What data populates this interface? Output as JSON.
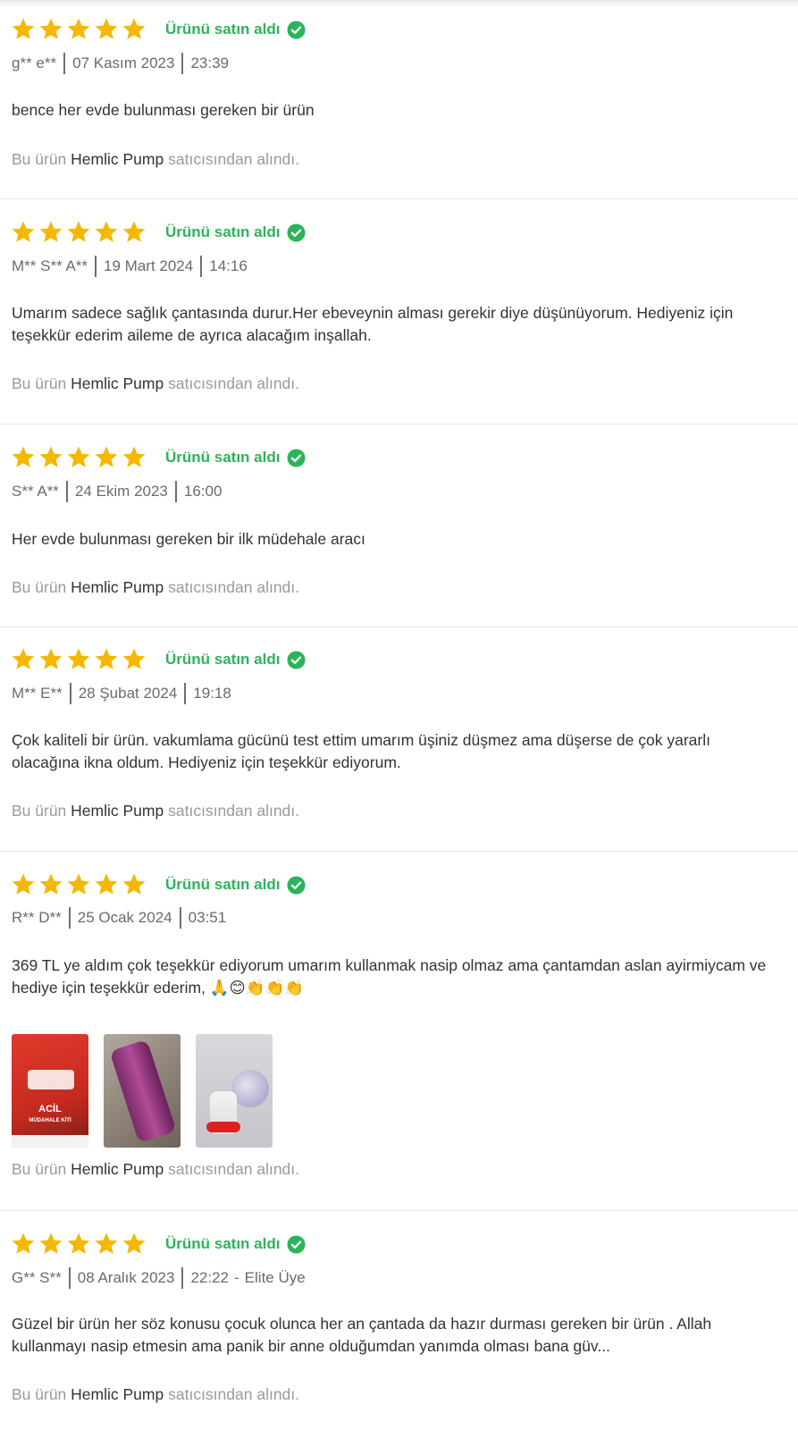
{
  "colors": {
    "star": "#f5b800",
    "bought": "#2cb45a",
    "muted": "#9a9a9a"
  },
  "bought_label": "Ürünü satın aldı",
  "icons": {
    "star": "star-icon",
    "verified": "check-circle-icon"
  },
  "reviews": [
    {
      "rating": 5,
      "user": "g** e**",
      "date": "07 Kasım 2023",
      "time": "23:39",
      "badge": "",
      "text": "bence her evde bulunması gereken bir ürün",
      "seller_prefix": "Bu ürün",
      "seller_name": "Hemlic Pump",
      "seller_suffix": "satıcısından alındı."
    },
    {
      "rating": 5,
      "user": "M** S** A**",
      "date": "19 Mart 2024",
      "time": "14:16",
      "badge": "",
      "text": "Umarım sadece sağlık çantasında durur.Her ebeveynin alması gerekir diye düşünüyorum. Hediyeniz için teşekkür ederim aileme de ayrıca alacağım inşallah.",
      "seller_prefix": "Bu ürün",
      "seller_name": "Hemlic Pump",
      "seller_suffix": "satıcısından alındı."
    },
    {
      "rating": 5,
      "user": "S** A**",
      "date": "24 Ekim 2023",
      "time": "16:00",
      "badge": "",
      "text": "Her evde bulunması gereken bir ilk müdehale aracı",
      "seller_prefix": "Bu ürün",
      "seller_name": "Hemlic Pump",
      "seller_suffix": "satıcısından alındı."
    },
    {
      "rating": 5,
      "user": "M** E**",
      "date": "28 Şubat 2024",
      "time": "19:18",
      "badge": "",
      "text": "Çok kaliteli bir ürün. vakumlama gücünü test ettim umarım üşiniz düşmez ama düşerse de çok yararlı olacağına ikna oldum. Hediyeniz için teşekkür ediyorum.",
      "seller_prefix": "Bu ürün",
      "seller_name": "Hemlic Pump",
      "seller_suffix": "satıcısından alındı."
    },
    {
      "rating": 5,
      "user": "R** D**",
      "date": "25 Ocak 2024",
      "time": "03:51",
      "badge": "",
      "text": "369 TL ye aldım çok teşekkür ediyorum umarım kullanmak nasip olmaz ama çantamdan aslan ayirmiycam ve hediye için teşekkür ederim, 🙏😊👏👏👏",
      "photos": [
        {
          "label": "ACİL",
          "sublabel": "MÜDAHALE KİTİ"
        },
        {
          "label": ""
        },
        {
          "label": ""
        }
      ],
      "seller_prefix": "Bu ürün",
      "seller_name": "Hemlic Pump",
      "seller_suffix": "satıcısından alındı."
    },
    {
      "rating": 5,
      "user": "G** S**",
      "date": "08 Aralık 2023",
      "time": "22:22",
      "badge": "Elite Üye",
      "text": "Güzel bir ürün her söz konusu çocuk olunca her an çantada da hazır durması gereken bir ürün . Allah kullanmayı nasip etmesin ama panik bir anne olduğumdan yanımda olması bana güv...",
      "seller_prefix": "Bu ürün",
      "seller_name": "Hemlic Pump",
      "seller_suffix": "satıcısından alındı."
    }
  ]
}
